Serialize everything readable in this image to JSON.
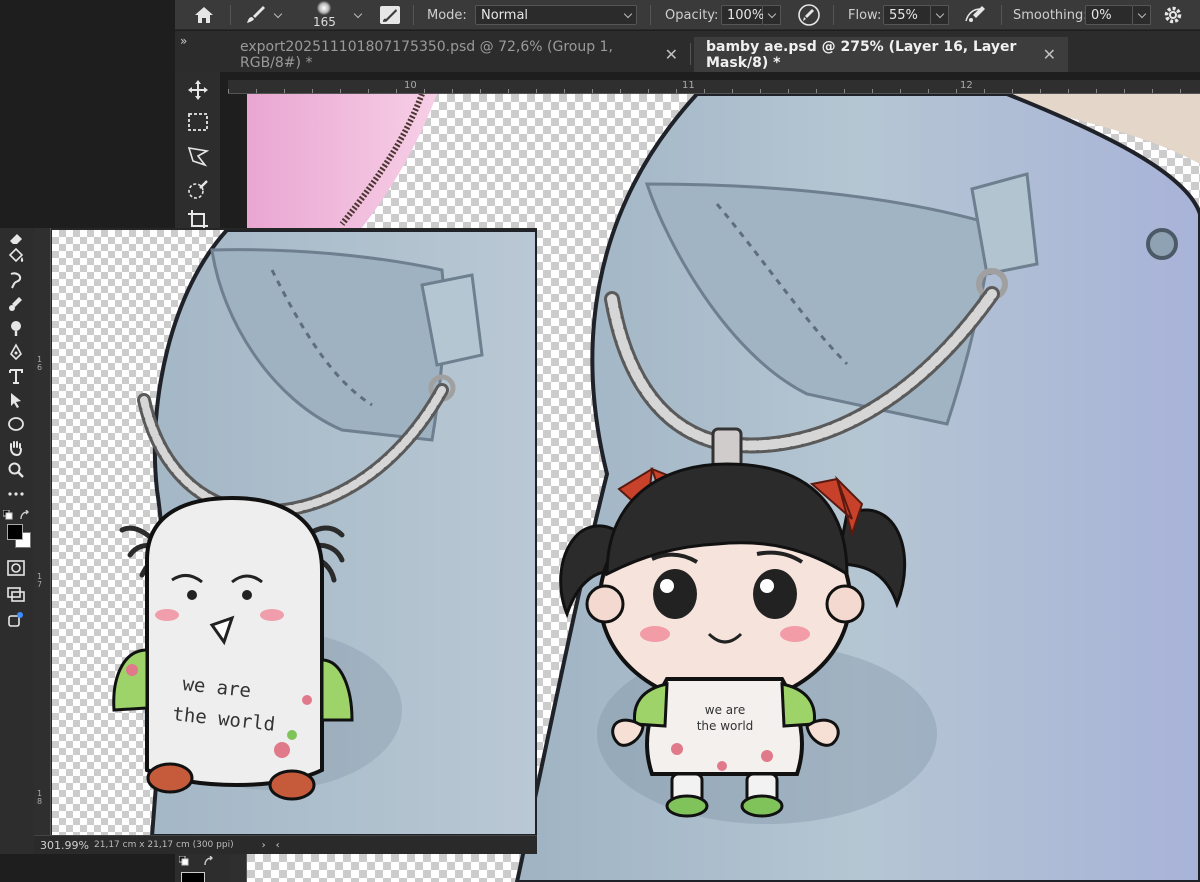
{
  "options_bar": {
    "brush_size": "165",
    "mode_label": "Mode:",
    "mode_value": "Normal",
    "opacity_label": "Opacity:",
    "opacity_value": "100%",
    "flow_label": "Flow:",
    "flow_value": "55%",
    "smoothing_label": "Smoothing:",
    "smoothing_value": "0%"
  },
  "tabs": [
    {
      "label": "export202511101807175350.psd @ 72,6% (Group 1, RGB/8#) *",
      "active": false
    },
    {
      "label": "bamby ae.psd @ 275% (Layer 16, Layer Mask/8) *",
      "active": true
    }
  ],
  "panel_collapse": "»",
  "ruler": {
    "labels": [
      "10",
      "11",
      "12"
    ]
  },
  "win2_ruler": {
    "labels": [
      "1\n6",
      "1\n7",
      "1\n8"
    ]
  },
  "inset_doc": {
    "zoom": "301.99%",
    "size": "21,17 cm x 21,17 cm (300 ppi)",
    "shirt_line1": "we are",
    "shirt_line2": "the world"
  },
  "main_doc": {
    "shirt_line1": "we are",
    "shirt_line2": "the world"
  },
  "colors": {
    "ui_dark": "#2d2d2d",
    "options_bg": "#3a3a3a",
    "denim": "#a9bccb",
    "chain": "#c0c0c0",
    "bow_red": "#c8422b",
    "sleeve_green": "#9ed36a"
  },
  "icons": [
    "home-icon",
    "brush-icon",
    "brush-settings-icon",
    "opacity-pressure-icon",
    "airbrush-icon",
    "gear-icon",
    "move-icon",
    "marquee-icon",
    "lasso-icon",
    "quick-select-icon",
    "crop-icon",
    "eraser-icon",
    "paint-bucket-icon",
    "smudge-icon",
    "dodge-icon",
    "pen-icon",
    "type-icon",
    "path-select-icon",
    "ellipse-icon",
    "hand-icon",
    "zoom-icon",
    "more-tools-icon",
    "swap-colors-icon",
    "quick-mask-icon",
    "screen-mode-icon",
    "share-icon"
  ]
}
